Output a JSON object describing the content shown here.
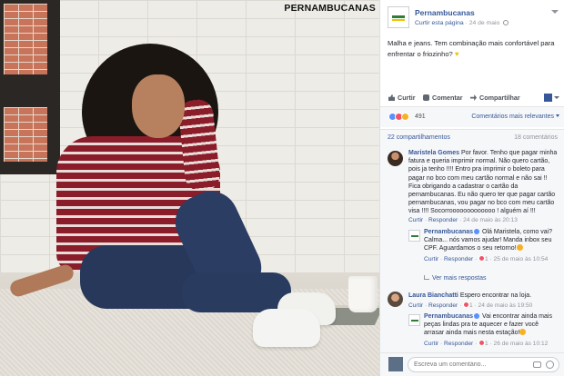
{
  "photo": {
    "watermark": "PERNAMBUCANAS"
  },
  "post": {
    "page_name": "Pernambucanas",
    "follow_link": "Curtir esta página",
    "separator": "·",
    "date": "24 de maio",
    "caption": "Malha e jeans. Tem combinação mais confortável para enfrentar o friozinho?"
  },
  "actions": {
    "like": "Curtir",
    "comment": "Comentar",
    "share": "Compartilhar"
  },
  "reactions": {
    "count": "491",
    "relevant": "Comentários mais relevantes"
  },
  "stats": {
    "shares": "22 compartilhamentos",
    "comments": "18 comentários"
  },
  "comments": [
    {
      "author": "Maristela Gomes",
      "text": "Por favor. Tenho que pagar minha fatura e queria imprimir normal. Não quero cartão, pois ja tenho !!!! Entro pra imprimir o boleto para pagar no bco com meu cartão normal e não sai !! Fica obrigando a cadastrar o cartão da pernambucanas. Eu não quero ter que pagar cartão pernambucanas, vou pagar no bco com meu cartão visa !!!! Socorrooooooooooooo ! alguém aí !!!",
      "like": "Curtir",
      "reply": "Responder",
      "time": "24 de maio às 20:13"
    },
    {
      "author": "Pernambucanas",
      "text": "Olá Maristela, como vai? Calma... nós vamos ajudar! Manda inbox seu CPF. Aguardamos o seu retorno!",
      "like": "Curtir",
      "reply": "Responder",
      "likes": "1",
      "time": "25 de maio às 10:54"
    },
    {
      "more_replies": "Ver mais respostas"
    },
    {
      "author": "Laura Bianchatti",
      "text": "Espero encontrar na loja.",
      "like": "Curtir",
      "reply": "Responder",
      "likes": "1",
      "time": "24 de maio às 19:50"
    },
    {
      "author": "Pernambucanas",
      "text": "Vai encontrar ainda mais peças lindas pra te aquecer e fazer você arrasar ainda mais nesta estação!",
      "like": "Curtir",
      "reply": "Responder",
      "likes": "1",
      "time": "26 de maio às 10:12"
    }
  ],
  "compose": {
    "placeholder": "Escreva um comentário..."
  },
  "colors": {
    "link": "#365899",
    "accent": "#f2c200",
    "sweater": "#8b1c2a",
    "jeans": "#27385a"
  },
  "icons": [
    "globe-icon",
    "chevron-down-icon",
    "like-icon",
    "comment-icon",
    "share-icon",
    "camera-icon",
    "emoji-icon"
  ]
}
